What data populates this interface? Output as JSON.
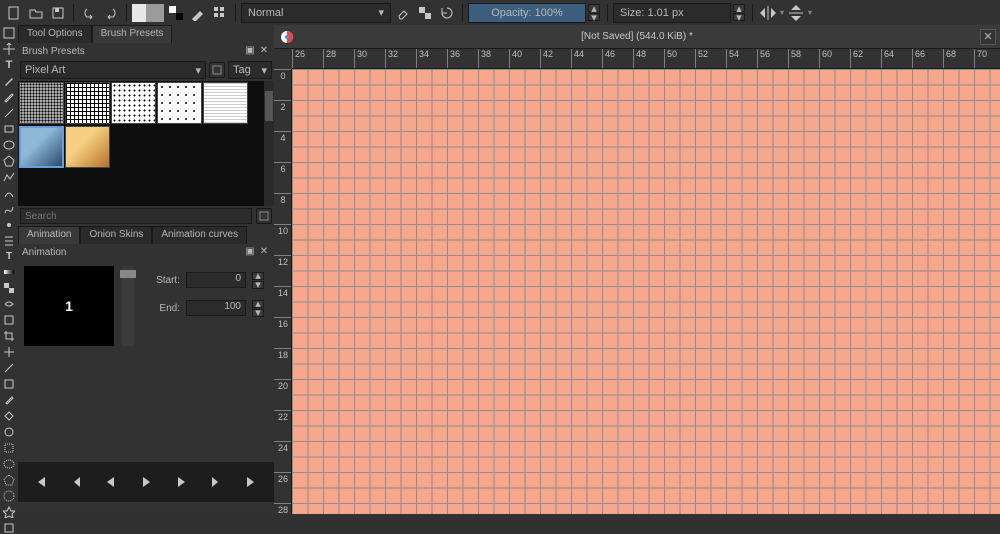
{
  "toolbar": {
    "blend_mode": "Normal",
    "opacity_label": "Opacity: 100%",
    "size_label": "Size: 1.01 px"
  },
  "panel": {
    "tabs": [
      "Tool Options",
      "Brush Presets"
    ],
    "active_tab": 1,
    "header": "Brush Presets",
    "category": "Pixel Art",
    "tag_label": "Tag",
    "search_placeholder": "Search"
  },
  "animation": {
    "tabs": [
      "Animation",
      "Onion Skins",
      "Animation curves"
    ],
    "header": "Animation",
    "current_frame": "1",
    "start_label": "Start:",
    "start_value": "0",
    "end_label": "End:",
    "end_value": "100"
  },
  "document": {
    "title": "[Not Saved]  (544.0 KiB) *"
  },
  "h_ticks": [
    26,
    28,
    30,
    32,
    34,
    36,
    38,
    40,
    42,
    44,
    46,
    48,
    50,
    52,
    54,
    56,
    58,
    60,
    62,
    64,
    66,
    68,
    70
  ],
  "v_ticks": [
    0,
    2,
    4,
    6,
    8,
    10,
    12,
    14,
    16,
    18,
    20,
    22,
    24,
    26,
    28
  ],
  "canvas_color": "#f7a78b"
}
